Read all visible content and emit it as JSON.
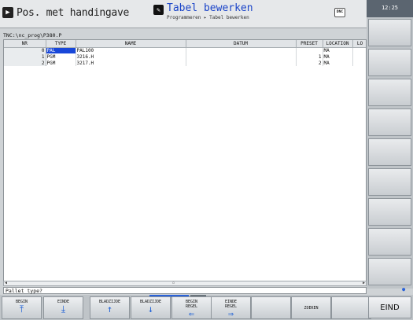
{
  "header": {
    "left_mode_title": "Pos. met handingave",
    "right_mode_title": "Tabel bewerken",
    "breadcrumb": "Programmeren ▸ Tabel bewerken",
    "dnc_label": "DNC",
    "clock": "12:25"
  },
  "path": "TNC:\\nc_prog\\P380.P",
  "table": {
    "columns": [
      "NR",
      "TYPE",
      "NAME",
      "DATUM",
      "PRESET",
      "LOCATION",
      "LO"
    ],
    "rows": [
      {
        "nr": "0",
        "type": "PAL",
        "name": "PAL100",
        "datum": "",
        "preset": "",
        "location": "MA"
      },
      {
        "nr": "1",
        "type": "PGM",
        "name": "3216.H",
        "datum": "",
        "preset": "1",
        "location": "MA"
      },
      {
        "nr": "2",
        "type": "PGM",
        "name": "3217.H",
        "datum": "",
        "preset": "2",
        "location": "MA"
      }
    ]
  },
  "status_text": "Pallet type?",
  "softkeys": {
    "begin": "BEGIN",
    "einde": "EINDE",
    "bladzijde_up": "BLADZIJDE",
    "bladzijde_down": "BLADZIJDE",
    "begin_regel": [
      "BEGIN",
      "REGEL"
    ],
    "einde_regel": [
      "EINDE",
      "REGEL"
    ],
    "zoeken": "ZOEKEN",
    "eind": "EIND"
  },
  "colors": {
    "accent": "#1a44c8",
    "selection": "#1847d9",
    "arrow": "#1c5fd6"
  }
}
